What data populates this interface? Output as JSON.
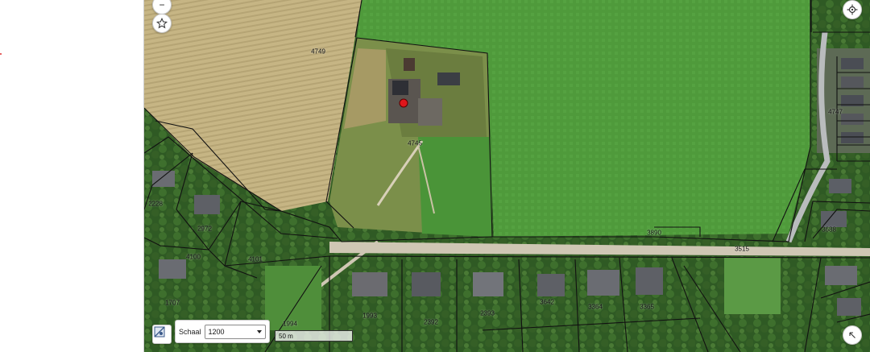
{
  "map": {
    "parcels": [
      {
        "label": "4749"
      },
      {
        "label": "4745"
      },
      {
        "label": "4747"
      },
      {
        "label": "3890"
      },
      {
        "label": "3515"
      },
      {
        "label": "3688"
      },
      {
        "label": "2228"
      },
      {
        "label": "2972"
      },
      {
        "label": "4100"
      },
      {
        "label": "4101"
      },
      {
        "label": "1707"
      },
      {
        "label": "1994"
      },
      {
        "label": "1993"
      },
      {
        "label": "2392"
      },
      {
        "label": "2393"
      },
      {
        "label": "3364"
      },
      {
        "label": "3365"
      },
      {
        "label": "3642"
      },
      {
        "label": "3365"
      }
    ],
    "marker_color": "#e0161b",
    "parcel_line_color": "#111111"
  },
  "controls": {
    "zoom_out": "−",
    "favorite_icon": "star-icon",
    "locate_icon": "crosshair-icon",
    "expand_icon": "arrow-up-left-icon",
    "tool_icon": "map-tool-icon"
  },
  "scale": {
    "label": "Schaal",
    "value": "1200",
    "bar_text": "50 m"
  }
}
